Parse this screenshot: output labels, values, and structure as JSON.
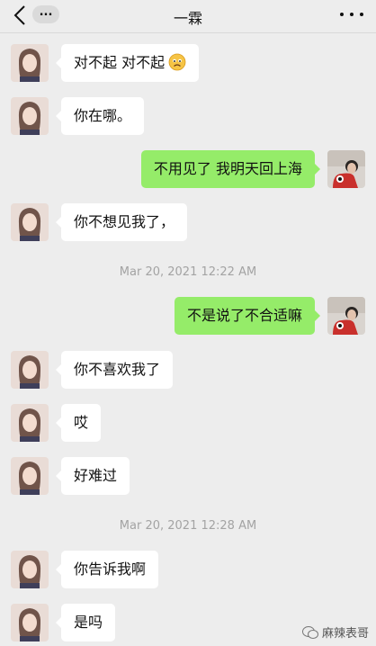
{
  "header": {
    "title": "一霖",
    "unread_badge": "...",
    "back_icon": "chevron-left-icon",
    "more_icon": "more-dots-icon"
  },
  "messages": [
    {
      "side": "in",
      "text": "对不起 对不起",
      "emoji": "sad-face"
    },
    {
      "side": "in",
      "text": "你在哪。"
    },
    {
      "side": "out",
      "text": "不用见了 我明天回上海"
    },
    {
      "side": "in",
      "text": "你不想见我了，"
    },
    {
      "side": "out",
      "text": "不是说了不合适嘛"
    },
    {
      "side": "in",
      "text": "你不喜欢我了"
    },
    {
      "side": "in",
      "text": "哎"
    },
    {
      "side": "in",
      "text": "好难过"
    },
    {
      "side": "in",
      "text": "你告诉我啊"
    },
    {
      "side": "in",
      "text": "是吗"
    }
  ],
  "timestamps": [
    "Mar 20, 2021 12:22 AM",
    "Mar 20, 2021 12:28 AM"
  ],
  "watermark": {
    "text": "麻辣表哥",
    "icon": "wechat-icon"
  },
  "colors": {
    "background": "#ededed",
    "incoming_bubble": "#ffffff",
    "outgoing_bubble": "#95ec69",
    "timestamp": "#a3a3a3"
  }
}
